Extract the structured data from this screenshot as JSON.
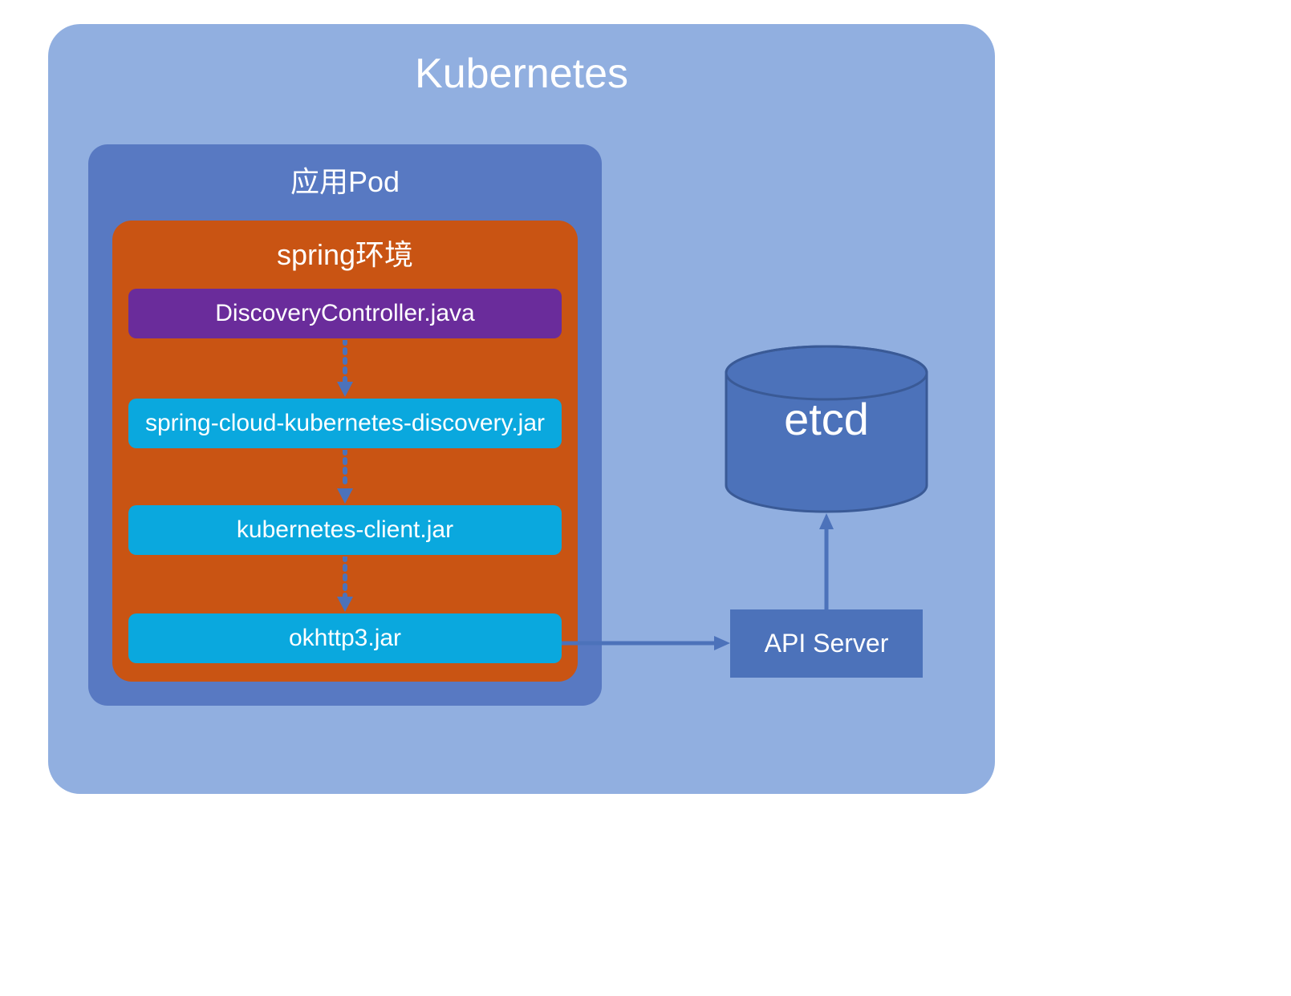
{
  "diagram": {
    "outer_title": "Kubernetes",
    "pod_title": "应用Pod",
    "spring_title": "spring环境",
    "layers": {
      "controller": "DiscoveryController.java",
      "discovery": "spring-cloud-kubernetes-discovery.jar",
      "client": "kubernetes-client.jar",
      "okhttp": "okhttp3.jar"
    },
    "api_server": "API Server",
    "etcd": "etcd"
  },
  "chart_data": {
    "type": "diagram",
    "nodes": [
      {
        "id": "k8s",
        "label": "Kubernetes",
        "type": "container"
      },
      {
        "id": "pod",
        "label": "应用Pod",
        "type": "container",
        "parent": "k8s"
      },
      {
        "id": "spring",
        "label": "spring环境",
        "type": "container",
        "parent": "pod"
      },
      {
        "id": "controller",
        "label": "DiscoveryController.java",
        "parent": "spring",
        "color": "#6a2c9b"
      },
      {
        "id": "discovery",
        "label": "spring-cloud-kubernetes-discovery.jar",
        "parent": "spring",
        "color": "#0aa8de"
      },
      {
        "id": "client",
        "label": "kubernetes-client.jar",
        "parent": "spring",
        "color": "#0aa8de"
      },
      {
        "id": "okhttp",
        "label": "okhttp3.jar",
        "parent": "spring",
        "color": "#0aa8de"
      },
      {
        "id": "apiserver",
        "label": "API Server",
        "parent": "k8s",
        "color": "#4c72ba"
      },
      {
        "id": "etcd",
        "label": "etcd",
        "parent": "k8s",
        "shape": "cylinder",
        "color": "#4c72ba"
      }
    ],
    "edges": [
      {
        "from": "controller",
        "to": "discovery",
        "style": "dotted"
      },
      {
        "from": "discovery",
        "to": "client",
        "style": "dotted"
      },
      {
        "from": "client",
        "to": "okhttp",
        "style": "dotted"
      },
      {
        "from": "okhttp",
        "to": "apiserver",
        "style": "solid"
      },
      {
        "from": "apiserver",
        "to": "etcd",
        "style": "solid"
      }
    ]
  }
}
